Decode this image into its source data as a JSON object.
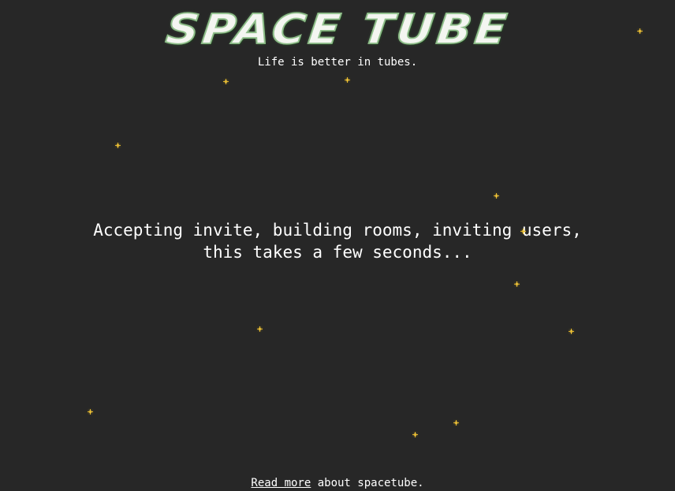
{
  "header": {
    "logo_text": "SPACE TUBE",
    "tagline": "Life is better in tubes."
  },
  "main": {
    "status_line_1": "Accepting invite, building rooms, inviting users,",
    "status_line_2": "this takes a few seconds..."
  },
  "footer": {
    "link_text": "Read more",
    "suffix_text": " about spacetube."
  },
  "colors": {
    "background": "#272727",
    "text": "#ffffff",
    "star": "#ffd54a",
    "logo_outline": "#8fbf8a"
  }
}
